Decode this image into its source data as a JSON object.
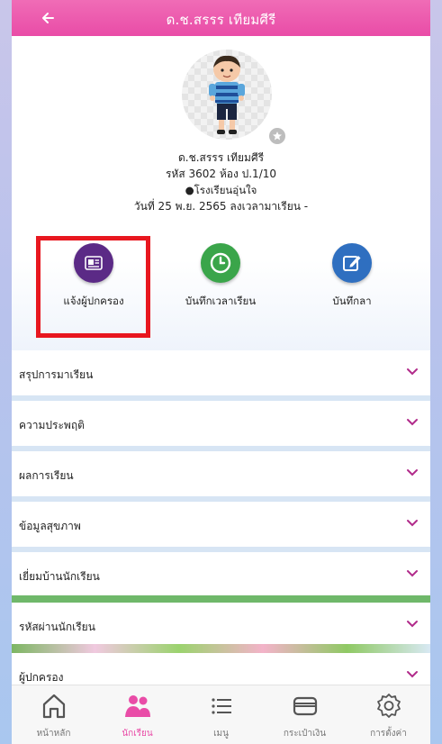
{
  "header": {
    "title": "ด.ช.สรรร เทียมศีรี"
  },
  "profile": {
    "name": "ด.ช.สรรร เทียมศีรี",
    "id_line": "รหัส 3602 ห้อง ป.1/10",
    "status": "●โรงเรียนอุ่นใจ",
    "date_line": "วันที่ 25 พ.ย. 2565  ลงเวลามาเรียน -"
  },
  "actions": [
    {
      "label": "แจ้งผู้ปกครอง",
      "icon": "notice-board-icon",
      "color": "#5b2a86"
    },
    {
      "label": "บันทึกเวลาเรียน",
      "icon": "clock-icon",
      "color": "#3aa54a"
    },
    {
      "label": "บันทึกลา",
      "icon": "edit-icon",
      "color": "#2f6fc0"
    }
  ],
  "sections": [
    {
      "label": "สรุปการมาเรียน"
    },
    {
      "label": "ความประพฤติ"
    },
    {
      "label": "ผลการเรียน"
    },
    {
      "label": "ข้อมูลสุขภาพ"
    },
    {
      "label": "เยี่ยมบ้านนักเรียน"
    },
    {
      "label": "รหัสผ่านนักเรียน"
    },
    {
      "label": "ผู้ปกครอง"
    }
  ],
  "bottom_nav": [
    {
      "label": "หน้าหลัก",
      "icon": "home-icon",
      "active": false
    },
    {
      "label": "นักเรียน",
      "icon": "students-icon",
      "active": true
    },
    {
      "label": "เมนู",
      "icon": "menu-icon",
      "active": false
    },
    {
      "label": "กระเป๋าเงิน",
      "icon": "wallet-icon",
      "active": false
    },
    {
      "label": "การตั้งค่า",
      "icon": "settings-icon",
      "active": false
    }
  ],
  "colors": {
    "accent": "#e94ca7",
    "chevron": "#b12a8a",
    "highlight": "#e8171f"
  }
}
